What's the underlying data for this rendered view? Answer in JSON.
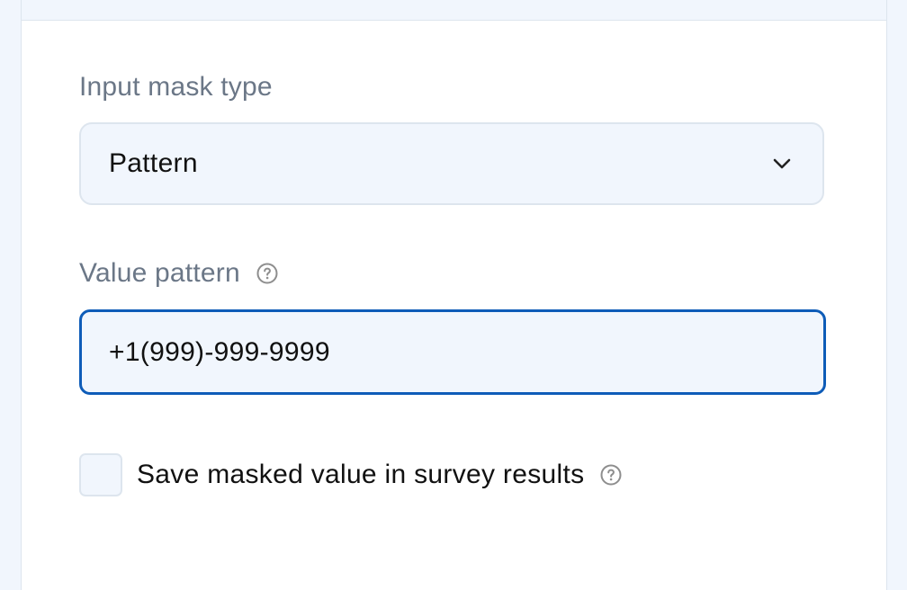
{
  "mask_type": {
    "label": "Input mask type",
    "selected": "Pattern"
  },
  "value_pattern": {
    "label": "Value pattern",
    "value": "+1(999)-999-9999"
  },
  "save_masked": {
    "label": "Save masked value in survey results",
    "checked": false
  },
  "icons": {
    "help": "question-circle-icon",
    "dropdown": "chevron-down-icon"
  },
  "colors": {
    "accent": "#0e5cb8",
    "field_background": "#f1f6fd",
    "label_text": "#6b7787"
  }
}
